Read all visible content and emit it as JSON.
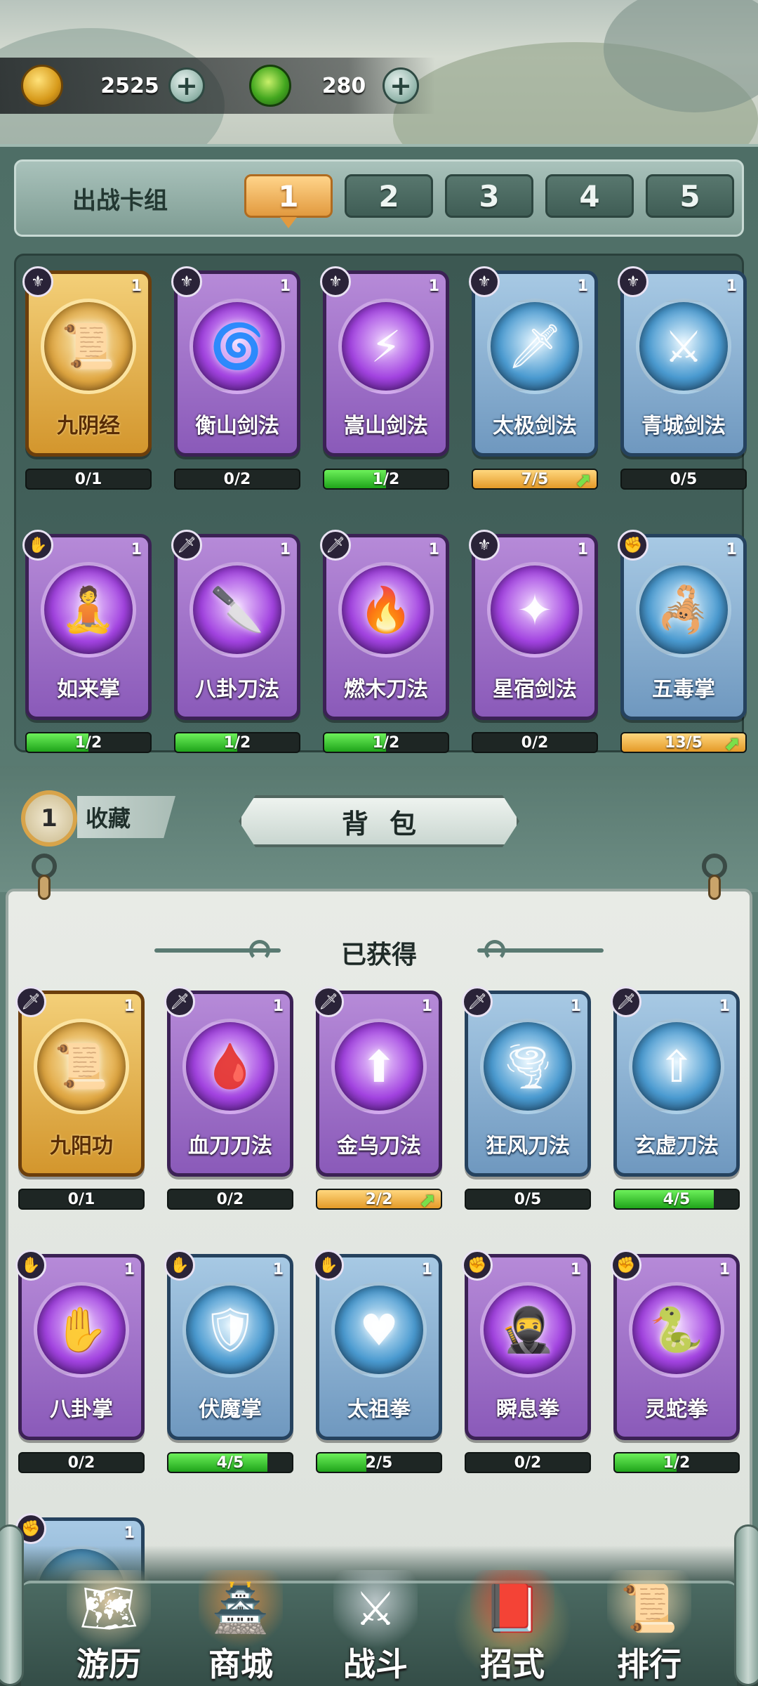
{
  "resources": {
    "coins": {
      "icon": "gold-coin-icon",
      "value": "2525",
      "add": "+"
    },
    "jade": {
      "icon": "jade-gem-icon",
      "value": "280",
      "add": "+"
    }
  },
  "deck": {
    "title": "出战卡组",
    "tabs": [
      "1",
      "2",
      "3",
      "4",
      "5"
    ],
    "active_tab": "1",
    "cards": [
      {
        "name": "九阴经",
        "level": "1",
        "rarity": "gold",
        "type_icon": "sword-crest-icon",
        "progress_text": "0/1",
        "progress": 0.0,
        "bar": "green",
        "upgrade": false,
        "glyph": "📜"
      },
      {
        "name": "衡山剑法",
        "level": "1",
        "rarity": "purple",
        "type_icon": "sword-crest-icon",
        "progress_text": "0/2",
        "progress": 0.0,
        "bar": "green",
        "upgrade": false,
        "glyph": "🌀"
      },
      {
        "name": "嵩山剑法",
        "level": "1",
        "rarity": "purple",
        "type_icon": "sword-crest-icon",
        "progress_text": "1/2",
        "progress": 0.5,
        "bar": "green",
        "upgrade": false,
        "glyph": "⚡"
      },
      {
        "name": "太极剑法",
        "level": "1",
        "rarity": "blue",
        "type_icon": "sword-crest-icon",
        "progress_text": "7/5",
        "progress": 1.0,
        "bar": "orange",
        "upgrade": true,
        "glyph": "🗡"
      },
      {
        "name": "青城剑法",
        "level": "1",
        "rarity": "blue",
        "type_icon": "sword-crest-icon",
        "progress_text": "0/5",
        "progress": 0.0,
        "bar": "green",
        "upgrade": false,
        "glyph": "⚔"
      },
      {
        "name": "如来掌",
        "level": "1",
        "rarity": "purple",
        "type_icon": "palm-icon",
        "progress_text": "1/2",
        "progress": 0.5,
        "bar": "green",
        "upgrade": false,
        "glyph": "🧘"
      },
      {
        "name": "八卦刀法",
        "level": "1",
        "rarity": "purple",
        "type_icon": "blade-icon",
        "progress_text": "1/2",
        "progress": 0.5,
        "bar": "green",
        "upgrade": false,
        "glyph": "🔪"
      },
      {
        "name": "燃木刀法",
        "level": "1",
        "rarity": "purple",
        "type_icon": "blade-icon",
        "progress_text": "1/2",
        "progress": 0.5,
        "bar": "green",
        "upgrade": false,
        "glyph": "🔥"
      },
      {
        "name": "星宿剑法",
        "level": "1",
        "rarity": "purple",
        "type_icon": "sword-crest-icon",
        "progress_text": "0/2",
        "progress": 0.0,
        "bar": "green",
        "upgrade": false,
        "glyph": "✦"
      },
      {
        "name": "五毒掌",
        "level": "1",
        "rarity": "blue",
        "type_icon": "fist-icon",
        "progress_text": "13/5",
        "progress": 1.0,
        "bar": "orange",
        "upgrade": true,
        "glyph": "🦂"
      }
    ]
  },
  "collection_bar": {
    "count": "1",
    "label": "收藏",
    "bag_label": "背包"
  },
  "obtained": {
    "title": "已获得",
    "cards": [
      {
        "name": "九阳功",
        "level": "1",
        "rarity": "gold",
        "type_icon": "blade-icon",
        "progress_text": "0/1",
        "progress": 0.0,
        "bar": "green",
        "upgrade": false,
        "glyph": "📜"
      },
      {
        "name": "血刀刀法",
        "level": "1",
        "rarity": "purple",
        "type_icon": "blade-icon",
        "progress_text": "0/2",
        "progress": 0.0,
        "bar": "green",
        "upgrade": false,
        "glyph": "🩸"
      },
      {
        "name": "金乌刀法",
        "level": "1",
        "rarity": "purple",
        "type_icon": "blade-icon",
        "progress_text": "2/2",
        "progress": 1.0,
        "bar": "orange",
        "upgrade": true,
        "glyph": "⬆"
      },
      {
        "name": "狂风刀法",
        "level": "1",
        "rarity": "blue",
        "type_icon": "blade-icon",
        "progress_text": "0/5",
        "progress": 0.0,
        "bar": "green",
        "upgrade": false,
        "glyph": "🌪"
      },
      {
        "name": "玄虚刀法",
        "level": "1",
        "rarity": "blue",
        "type_icon": "blade-icon",
        "progress_text": "4/5",
        "progress": 0.8,
        "bar": "green",
        "upgrade": false,
        "glyph": "⇧"
      },
      {
        "name": "八卦掌",
        "level": "1",
        "rarity": "purple",
        "type_icon": "palm-icon",
        "progress_text": "0/2",
        "progress": 0.0,
        "bar": "green",
        "upgrade": false,
        "glyph": "✋"
      },
      {
        "name": "伏魔掌",
        "level": "1",
        "rarity": "blue",
        "type_icon": "palm-icon",
        "progress_text": "4/5",
        "progress": 0.8,
        "bar": "green",
        "upgrade": false,
        "glyph": "🛡"
      },
      {
        "name": "太祖拳",
        "level": "1",
        "rarity": "blue",
        "type_icon": "palm-icon",
        "progress_text": "2/5",
        "progress": 0.4,
        "bar": "green",
        "upgrade": false,
        "glyph": "♥"
      },
      {
        "name": "瞬息拳",
        "level": "1",
        "rarity": "purple",
        "type_icon": "fist-icon",
        "progress_text": "0/2",
        "progress": 0.0,
        "bar": "green",
        "upgrade": false,
        "glyph": "🥷"
      },
      {
        "name": "灵蛇拳",
        "level": "1",
        "rarity": "purple",
        "type_icon": "fist-icon",
        "progress_text": "1/2",
        "progress": 0.5,
        "bar": "green",
        "upgrade": false,
        "glyph": "🐍"
      },
      {
        "name": "",
        "level": "1",
        "rarity": "blue",
        "type_icon": "fist-icon",
        "progress_text": "",
        "progress": 0.0,
        "bar": "green",
        "upgrade": false,
        "glyph": ""
      }
    ]
  },
  "nav": [
    {
      "label": "游历",
      "icon": "travel-map-icon",
      "glyph": "🗺",
      "active": false
    },
    {
      "label": "商城",
      "icon": "shop-pagoda-icon",
      "glyph": "🏯",
      "active": false
    },
    {
      "label": "战斗",
      "icon": "crossed-swords-icon",
      "glyph": "⚔",
      "active": false
    },
    {
      "label": "招式",
      "icon": "skill-book-icon",
      "glyph": "📕",
      "active": true
    },
    {
      "label": "排行",
      "icon": "ranking-scroll-icon",
      "glyph": "📜",
      "active": false
    }
  ],
  "colors": {
    "gold_card": "#d3962d",
    "purple_card": "#8a5ab9",
    "blue_card": "#6f98bf",
    "progress_green": "#1fa41a",
    "progress_orange": "#e59a28",
    "active_tab": "#e29a3f"
  }
}
